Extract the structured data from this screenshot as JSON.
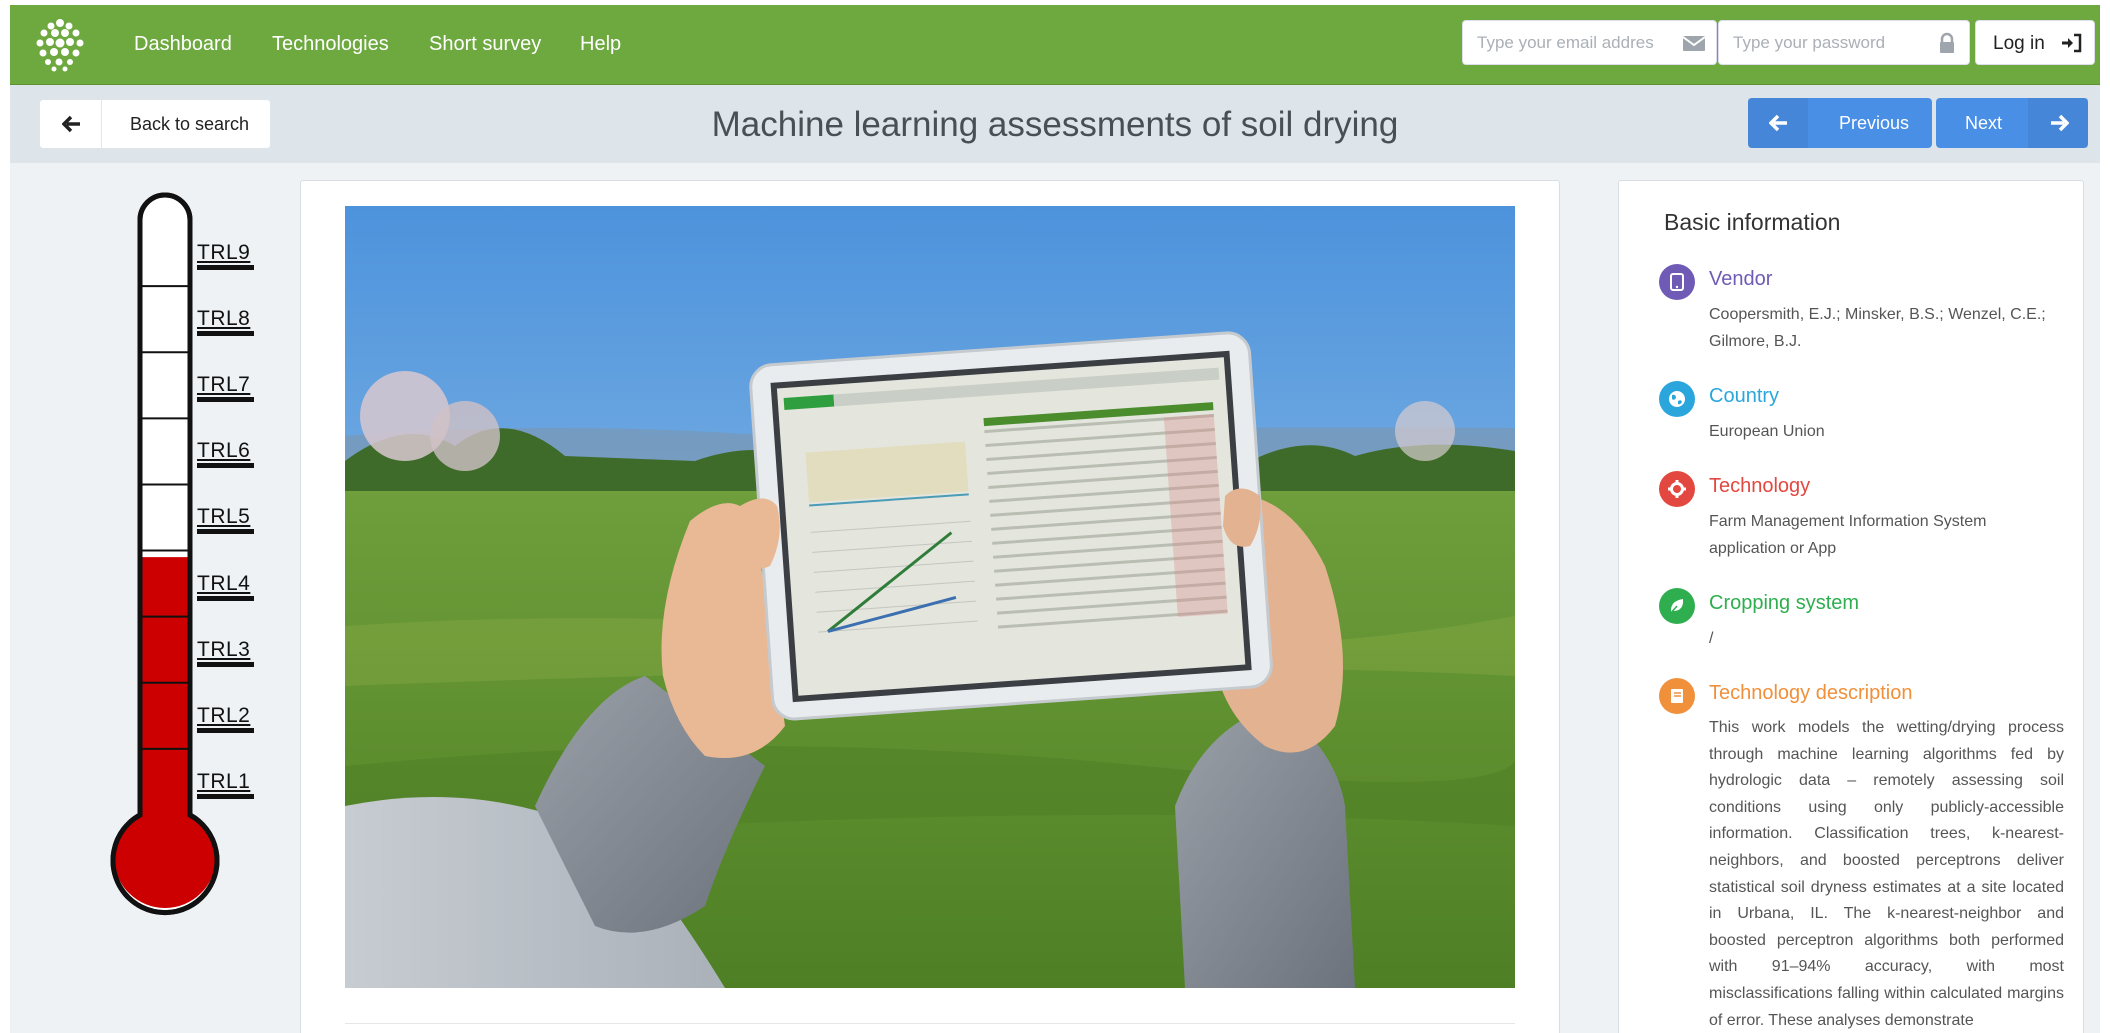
{
  "nav": {
    "items": [
      "Dashboard",
      "Technologies",
      "Short survey",
      "Help"
    ],
    "email_placeholder": "Type your email addres",
    "password_placeholder": "Type your password",
    "login_label": "Log in"
  },
  "subheader": {
    "back_label": "Back to search",
    "title": "Machine learning assessments of soil drying",
    "previous_label": "Previous",
    "next_label": "Next"
  },
  "trl": {
    "levels": [
      "TRL9",
      "TRL8",
      "TRL7",
      "TRL6",
      "TRL5",
      "TRL4",
      "TRL3",
      "TRL2",
      "TRL1"
    ],
    "current_level": 4,
    "fill_color": "#cc0000"
  },
  "basic_info": {
    "title": "Basic information",
    "fields": [
      {
        "label": "Vendor",
        "value": "Coopersmith, E.J.; Minsker, B.S.; Wenzel, C.E.; Gilmore, B.J.",
        "color": "#6f5bb5",
        "icon": "tablet-icon"
      },
      {
        "label": "Country",
        "value": "European Union",
        "color": "#2ba6dd",
        "icon": "globe-icon"
      },
      {
        "label": "Technology",
        "value": "Farm Management Information System application or App",
        "color": "#e2483f",
        "icon": "gear-icon"
      },
      {
        "label": "Cropping system",
        "value": "/",
        "color": "#2eae4e",
        "icon": "leaf-icon"
      },
      {
        "label": "Technology description",
        "value": "This work models the wetting/drying process through machine learning algorithms fed by hydrologic data – remotely assessing soil conditions using only publicly-accessible information. Classification trees, k-nearest-neighbors, and boosted perceptrons deliver statistical soil dryness estimates at a site located in Urbana, IL. The k-nearest-neighbor and boosted perceptron algorithms both performed with 91–94% accuracy, with most misclassifications falling within calculated margins of error. These analyses demonstrate",
        "color": "#f0903a",
        "icon": "book-icon"
      }
    ]
  },
  "colors": {
    "brand_green": "#6ea940",
    "pager_blue": "#4a8fe6"
  }
}
